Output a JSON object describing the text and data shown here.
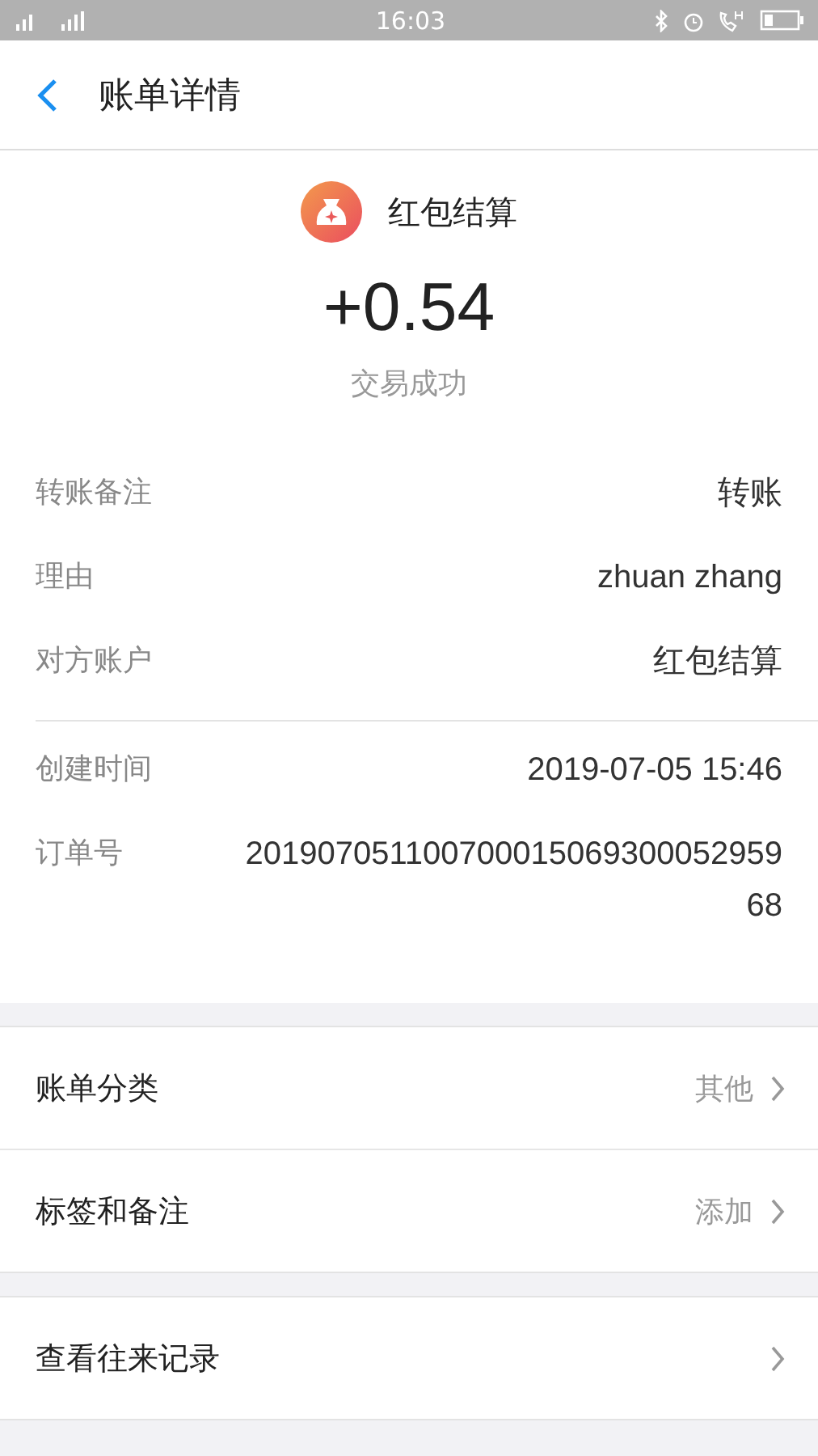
{
  "status_bar": {
    "time": "16:03"
  },
  "header": {
    "title": "账单详情"
  },
  "summary": {
    "merchant": "红包结算",
    "amount": "+0.54",
    "status": "交易成功"
  },
  "details": [
    {
      "label": "转账备注",
      "value": "转账"
    },
    {
      "label": "理由",
      "value": "zhuan zhang"
    },
    {
      "label": "对方账户",
      "value": "红包结算"
    }
  ],
  "details_2": [
    {
      "label": "创建时间",
      "value": "2019-07-05 15:46"
    },
    {
      "label": "订单号",
      "value": "20190705110070001506930005295968"
    }
  ],
  "menu_groups": [
    [
      {
        "label": "账单分类",
        "value": "其他"
      },
      {
        "label": "标签和备注",
        "value": "添加"
      }
    ],
    [
      {
        "label": "查看往来记录"
      }
    ]
  ]
}
